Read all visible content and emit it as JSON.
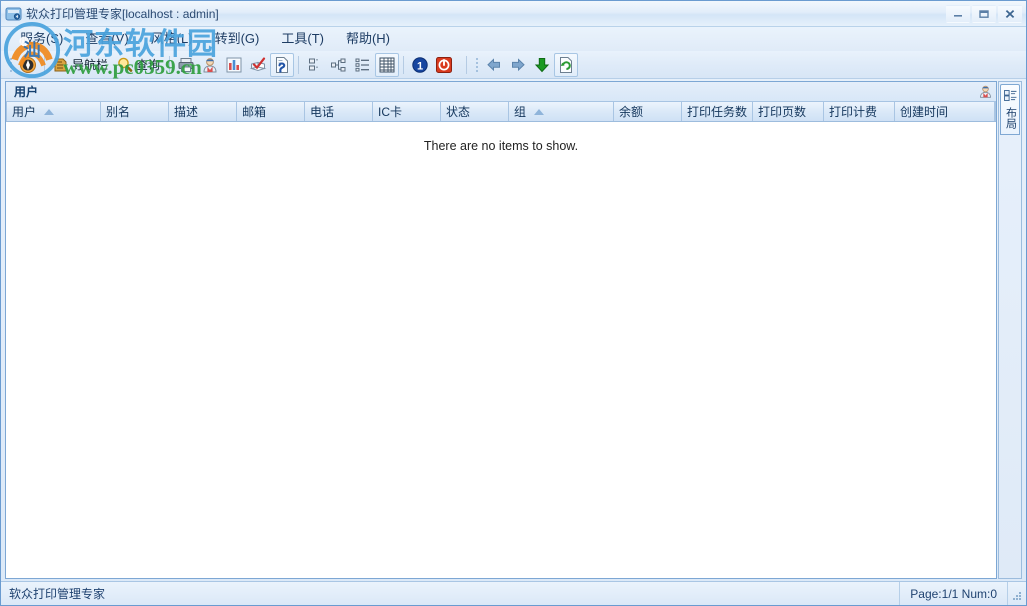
{
  "window": {
    "title": "软众打印管理专家[localhost : admin]",
    "app_icon": "app-window-icon",
    "minimize_label": "─",
    "maximize_label": "□",
    "close_label": "✕"
  },
  "menu": {
    "items": [
      {
        "label": "服务(S)",
        "name": "menu-service"
      },
      {
        "label": "查看(V)",
        "name": "menu-view"
      },
      {
        "label": "风格(L)",
        "name": "menu-style"
      },
      {
        "label": "转到(G)",
        "name": "menu-goto"
      },
      {
        "label": "工具(T)",
        "name": "menu-tools"
      },
      {
        "label": "帮助(H)",
        "name": "menu-help"
      }
    ]
  },
  "toolbar": {
    "groups": [
      {
        "items": [
          {
            "label": "",
            "icon": "compass-icon",
            "name": "toolbar-compass"
          }
        ]
      },
      {
        "items": [
          {
            "label": "导航栏",
            "icon": "navbar-icon",
            "name": "toolbar-navbar"
          },
          {
            "label": "查询",
            "icon": "magnifier-icon",
            "name": "toolbar-query"
          }
        ]
      },
      {
        "items": [
          {
            "label": "",
            "icon": "printer-icon",
            "name": "toolbar-printer"
          },
          {
            "label": "",
            "icon": "user-icon",
            "name": "toolbar-user"
          },
          {
            "label": "",
            "icon": "bar-chart-icon",
            "name": "toolbar-report"
          },
          {
            "label": "",
            "icon": "check-book-icon",
            "name": "toolbar-log"
          },
          {
            "label": "",
            "icon": "help-page-icon",
            "name": "toolbar-help-page"
          }
        ]
      },
      {
        "items": [
          {
            "label": "",
            "icon": "align-icon",
            "name": "toolbar-align"
          },
          {
            "label": "",
            "icon": "tree-icon",
            "name": "toolbar-tree"
          },
          {
            "label": "",
            "icon": "list-icon",
            "name": "toolbar-list"
          },
          {
            "label": "",
            "icon": "grid-icon",
            "name": "toolbar-grid"
          }
        ]
      },
      {
        "items": [
          {
            "label": "",
            "icon": "info-circle-icon",
            "name": "toolbar-info"
          },
          {
            "label": "",
            "icon": "power-icon",
            "name": "toolbar-power"
          }
        ]
      },
      {
        "items": [
          {
            "label": "",
            "icon": "back-arrow-icon",
            "name": "toolbar-back"
          },
          {
            "label": "",
            "icon": "forward-arrow-icon",
            "name": "toolbar-forward"
          },
          {
            "label": "",
            "icon": "down-arrow-icon",
            "name": "toolbar-down"
          },
          {
            "label": "",
            "icon": "refresh-page-icon",
            "name": "toolbar-refresh"
          }
        ]
      }
    ]
  },
  "panel": {
    "caption": "用户",
    "caption_icon": "user-icon",
    "dock_tab": "布局",
    "dock_tab_icon": "layout-icon"
  },
  "grid": {
    "columns": [
      {
        "label": "用户",
        "width": 95,
        "sorted": true
      },
      {
        "label": "别名",
        "width": 68,
        "sorted": false
      },
      {
        "label": "描述",
        "width": 68,
        "sorted": false
      },
      {
        "label": "邮箱",
        "width": 68,
        "sorted": false
      },
      {
        "label": "电话",
        "width": 68,
        "sorted": false
      },
      {
        "label": "IC卡",
        "width": 68,
        "sorted": false
      },
      {
        "label": "状态",
        "width": 68,
        "sorted": false
      },
      {
        "label": "组",
        "width": 105,
        "sorted": true
      },
      {
        "label": "余额",
        "width": 68,
        "sorted": false
      },
      {
        "label": "打印任务数",
        "width": 71,
        "sorted": false
      },
      {
        "label": "打印页数",
        "width": 71,
        "sorted": false
      },
      {
        "label": "打印计费",
        "width": 71,
        "sorted": false
      },
      {
        "label": "创建时间",
        "width": 100,
        "sorted": false
      }
    ],
    "rows": [],
    "empty_message": "There are no items to show."
  },
  "statusbar": {
    "left_text": "软众打印管理专家",
    "right_text": "Page:1/1 Num:0"
  },
  "watermark": {
    "chinese": "河东软件园",
    "url": "www.pc0359.cn"
  },
  "colors": {
    "accent": "#4a8fd4",
    "title_text": "#2b4a72",
    "panel_border": "#7da7d4",
    "watermark_blue": "#4aa3dd",
    "watermark_green": "#2f9e3f"
  }
}
